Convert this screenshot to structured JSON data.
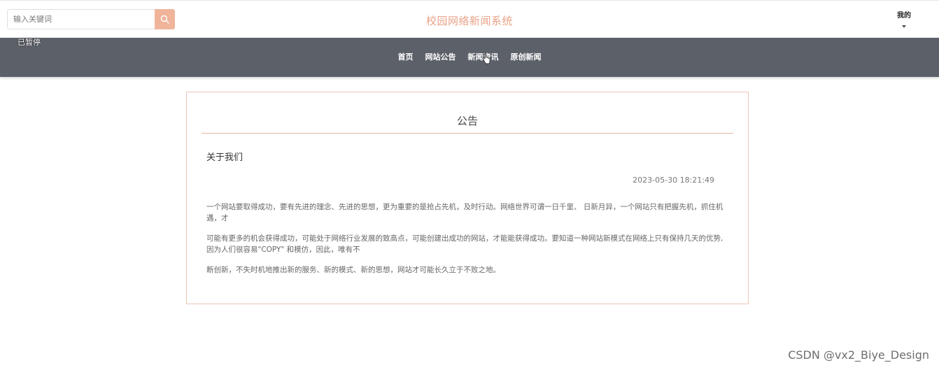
{
  "header": {
    "search_placeholder": "输入关键词",
    "site_title": "校园网络新闻系统",
    "user_menu_label": "我的"
  },
  "player_overlay": {
    "status": "已暂停"
  },
  "nav": {
    "items": [
      {
        "label": "首页"
      },
      {
        "label": "网站公告"
      },
      {
        "label": "新闻资讯"
      },
      {
        "label": "原创新闻"
      }
    ]
  },
  "notice": {
    "heading": "公告",
    "title": "关于我们",
    "date": "2023-05-30 18:21:49",
    "paragraphs": [
      "一个网站要取得成功，要有先进的理念、先进的思想，更为重要的是抢占先机，及时行动。网络世界可谓一日千里、 日新月异，一个网站只有把握先机，抓住机遇，才",
      "可能有更多的机会获得成功，可能处于网络行业发展的致高点，可能创建出成功的网站，才能能获得成功。要知道一种网站新模式在网络上只有保持几天的优势,因为人们很容易\"COPY\" 和模仿，因此，唯有不",
      "断创新，不失时机地推出新的服务、新的模式、新的思想，网站才可能长久立于不败之地。"
    ]
  },
  "watermark": {
    "text": "CSDN @vx2_Biye_Design"
  },
  "colors": {
    "accent": "#e9a287",
    "search_button": "#f0b49a",
    "navbar": "#5c6068",
    "card_border": "#ecc5b6"
  },
  "icons": {
    "search": "search-icon",
    "caret": "chevron-down-icon",
    "cursor": "hand-cursor-icon"
  }
}
